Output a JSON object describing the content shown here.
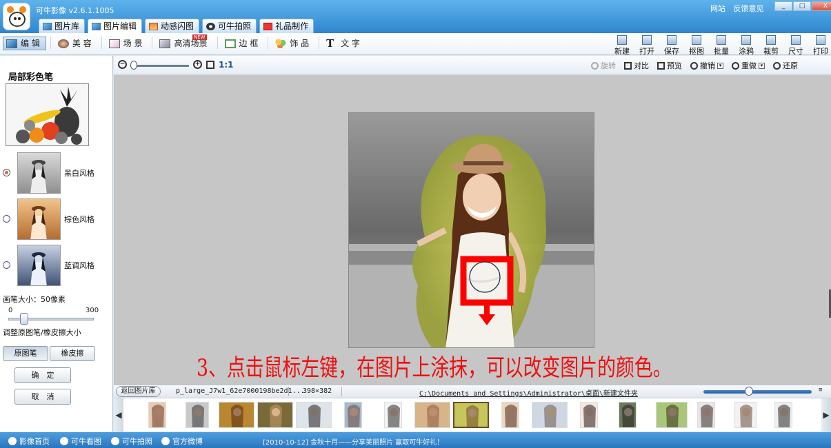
{
  "window": {
    "title": "可牛影像 v2.6.1.1005",
    "links": [
      "网站",
      "反馈意见"
    ],
    "controls": [
      "_",
      "□",
      "X"
    ]
  },
  "main_tabs": [
    {
      "label": "图片库",
      "icon": "photo-library-icon"
    },
    {
      "label": "图片编辑",
      "icon": "photo-edit-icon",
      "active": true
    },
    {
      "label": "动感闪图",
      "icon": "animated-gif-icon"
    },
    {
      "label": "可牛拍照",
      "icon": "camera-icon"
    },
    {
      "label": "礼品制作",
      "icon": "gift-icon"
    }
  ],
  "sub_tabs": [
    {
      "label": "编 辑",
      "icon": "edit-icon",
      "active": true
    },
    {
      "label": "美 容",
      "icon": "beauty-icon"
    },
    {
      "label": "场 景",
      "icon": "scene-icon"
    },
    {
      "label": "高清场景",
      "icon": "hd-scene-icon"
    },
    {
      "label": "边 框",
      "icon": "frame-icon"
    },
    {
      "label": "饰 品",
      "icon": "decoration-icon"
    },
    {
      "label": "文 字",
      "icon": "text-icon"
    }
  ],
  "sub_badge": "NEW",
  "right_tools": [
    "新建",
    "打开",
    "保存",
    "抠图",
    "批量",
    "涂鸦",
    "裁剪",
    "尺寸",
    "打印"
  ],
  "left_panel": {
    "title": "局部彩色笔",
    "styles": [
      {
        "label": "黑白风格",
        "selected": true
      },
      {
        "label": "棕色风格",
        "selected": false
      },
      {
        "label": "蓝调风格",
        "selected": false
      }
    ],
    "brush_size_label": "画笔大小：50像素",
    "slider_min": "0",
    "slider_max": "300",
    "brush_value": 50,
    "adjust_label": "调整原图笔/橡皮擦大小",
    "tool_buttons": [
      "原图笔",
      "橡皮擦"
    ],
    "ok": "确　定",
    "cancel": "取　消"
  },
  "zoom": {
    "ratio_label": "1:1"
  },
  "view_tools": [
    {
      "label": "旋转",
      "disabled": true
    },
    {
      "label": "对比"
    },
    {
      "label": "预览"
    },
    {
      "label": "撤销",
      "dropdown": true
    },
    {
      "label": "重做",
      "dropdown": true
    },
    {
      "label": "还原"
    }
  ],
  "instruction": "3、点击鼠标左键，在图片上涂抹，可以改变图片的颜色。",
  "status": {
    "back_button": "返回图片库",
    "file_name": "p_large_J7w1_62e7000198be2d1...",
    "dimensions": "398×382",
    "path": "C:\\Documents and Settings\\Administrator\\桌面\\新建文件夹"
  },
  "bottom": {
    "links": [
      "影像首页",
      "可牛看图",
      "可牛拍照",
      "官方微博"
    ],
    "news": "[2010-10-12] 金秋十月——分享美丽照片 赢取可牛好礼！"
  }
}
